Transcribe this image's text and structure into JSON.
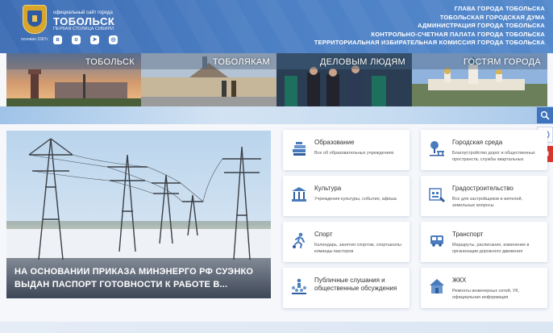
{
  "header": {
    "site_label": "официальный сайт города",
    "site_name": "ТОБОЛЬСК",
    "slogan": "ПЕРВАЯ СТОЛИЦА СИБИРИ",
    "founded": "основан 1587г.",
    "social": [
      "vk-icon",
      "ok-icon",
      "telegram-icon",
      "instagram-icon"
    ],
    "top_links": [
      "ГЛАВА ГОРОДА ТОБОЛЬСКА",
      "ТОБОЛЬСКАЯ ГОРОДСКАЯ ДУМА",
      "АДМИНИСТРАЦИЯ ГОРОДА ТОБОЛЬСКА",
      "КОНТРОЛЬНО-СЧЕТНАЯ ПАЛАТА ГОРОДА ТОБОЛЬСКА",
      "ТЕРРИТОРИАЛЬНАЯ ИЗБИРАТЕЛЬНАЯ КОМИССИЯ ГОРОДА ТОБОЛЬСКА"
    ]
  },
  "categories": [
    "ТОБОЛЬСК",
    "ТОБОЛЯКАМ",
    "ДЕЛОВЫМ ЛЮДЯМ",
    "ГОСТЯМ ГОРОДА"
  ],
  "side_buttons": [
    "search-icon",
    "phone-icon",
    "feedback-icon"
  ],
  "feature": {
    "line1": "НА ОСНОВАНИИ ПРИКАЗА МИНЭНЕРГО РФ СУЭНКО",
    "line2": "ВЫДАН ПАСПОРТ ГОТОВНОСТИ К РАБОТЕ В..."
  },
  "cards": [
    {
      "title": "Образование",
      "desc": "Все об образовательных учреждениях",
      "icon": "books-icon"
    },
    {
      "title": "Городская среда",
      "desc": "Благоустройство дорог и общественных пространств, службы квартальных",
      "icon": "park-icon"
    },
    {
      "title": "Культура",
      "desc": "Учреждения культуры, события, афиша",
      "icon": "museum-icon"
    },
    {
      "title": "Градостроительство",
      "desc": "Все для застройщиков и жителей, земельные вопросы",
      "icon": "building-plan-icon"
    },
    {
      "title": "Спорт",
      "desc": "Календарь, занятия спортом, спортшколы команды мастеров",
      "icon": "runner-icon"
    },
    {
      "title": "Транспорт",
      "desc": "Маршруты, расписания, изменение в организации дорожного движения",
      "icon": "bus-icon"
    },
    {
      "title_line1": "Публичные слушания и",
      "title_line2": "общественные обсуждения",
      "icon": "hearings-icon"
    },
    {
      "title": "ЖКХ",
      "desc": "Ремонты инженерных сетей, УК, официальная информация",
      "icon": "housing-icon"
    }
  ],
  "colors": {
    "header": "#4c7fc4",
    "icon_blue": "#4a7cbd",
    "accent_red": "#d9342b"
  }
}
